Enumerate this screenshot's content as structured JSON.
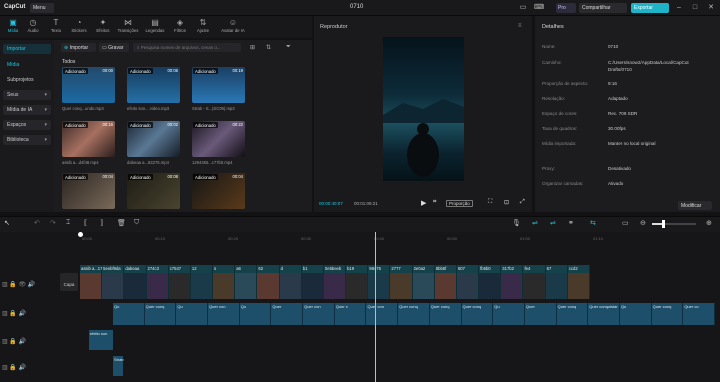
{
  "app": {
    "logo": "CapCut",
    "menu": "Menu",
    "title": "0710",
    "pro": "Pro",
    "share": "Compartilhar",
    "export": "Exportar"
  },
  "toolbar": {
    "tabs": [
      "Mídia",
      "Áudio",
      "Texto",
      "Stickers",
      "Efeitos",
      "Transições",
      "Legendas",
      "Filtros",
      "Ajuste",
      "Avatar de IA"
    ]
  },
  "nav": {
    "import": "Importar",
    "media": "Mídia",
    "subprojects": "Subprojetos",
    "yours": "Seus",
    "ai_media": "Mídia de IA",
    "spaces": "Espaços",
    "library": "Biblioteca"
  },
  "media": {
    "import_btn": "Importar",
    "record_btn": "Gravar",
    "search_placeholder": "Pesquisa nomes de arquivos, cenas o...",
    "all": "Todos",
    "items": [
      {
        "tag": "Adicionado",
        "dur": "00:00",
        "name": "Quer conq...undo.mp3"
      },
      {
        "tag": "Adicionado",
        "dur": "00:06",
        "name": "efeito son... video.mp3"
      },
      {
        "tag": "Adicionado",
        "dur": "00:19",
        "name": "Strab - S...(SC09).mp3"
      },
      {
        "tag": "Adicionado",
        "dur": "00:16",
        "name": "assib a...d4f48.mp4"
      },
      {
        "tag": "Adicionado",
        "dur": "00:02",
        "name": "dabeaa a...83275.mp4"
      },
      {
        "tag": "Adicionado",
        "dur": "00:22",
        "name": "1294455...c77b0.mp4"
      },
      {
        "tag": "Adicionado",
        "dur": "00:04",
        "name": ""
      },
      {
        "tag": "Adicionado",
        "dur": "00:08",
        "name": ""
      },
      {
        "tag": "Adicionado",
        "dur": "00:04",
        "name": ""
      }
    ]
  },
  "player": {
    "title": "Reprodutor",
    "current": "00:00:40:07",
    "total": "00:01:09:21",
    "ratio": "Proporção"
  },
  "details": {
    "title": "Detalhes",
    "rows": [
      {
        "label": "Nome:",
        "value": "0710"
      },
      {
        "label": "Caminho:",
        "value": "C:/Users/snow2/AppData/Local/CapCut Drafts/0710"
      },
      {
        "label": "Proporção de aspecto:",
        "value": "9:16"
      },
      {
        "label": "Resolução:",
        "value": "Adaptado"
      },
      {
        "label": "Espaço de cores:",
        "value": "Rec. 709 SDR"
      },
      {
        "label": "Taxa de quadros:",
        "value": "30.00fps"
      },
      {
        "label": "Mídia importada:",
        "value": "Manter no local original"
      },
      {
        "label": "Proxy:",
        "value": "Desativado"
      },
      {
        "label": "Organizar camadas:",
        "value": "Ativado"
      }
    ],
    "modify": "Modificar"
  },
  "timeline": {
    "ticks": [
      "00:00",
      "00:10",
      "00:20",
      "00:30",
      "00:40",
      "00:50",
      "01:00",
      "01:10"
    ],
    "cover": "Capa",
    "clips": [
      "assib a...17134",
      "5eebf9da",
      "dabeaa",
      "274c3",
      "c7547",
      "12",
      "s",
      "a6",
      "62",
      "d",
      "b1",
      "0e5beeb",
      "b19",
      "98475",
      "2777",
      "2e0a2",
      "8bb6f",
      "607",
      "fb5b0",
      "317b2",
      "fe4",
      "67",
      "ccd2"
    ],
    "audio": [
      "Qu",
      "Quer conq",
      "Qu",
      "Quer con",
      "Qu",
      "Quer",
      "Quer con",
      "Quer c",
      "Quer con",
      "Quer conq",
      "Quer conq",
      "Quer conq",
      "Qu",
      "Quer",
      "Quer conq",
      "Quer conquistar",
      "Qu",
      "Quer conq",
      "Quer co"
    ],
    "effect_clip": "efeito son",
    "strab_clip": "Strab"
  }
}
